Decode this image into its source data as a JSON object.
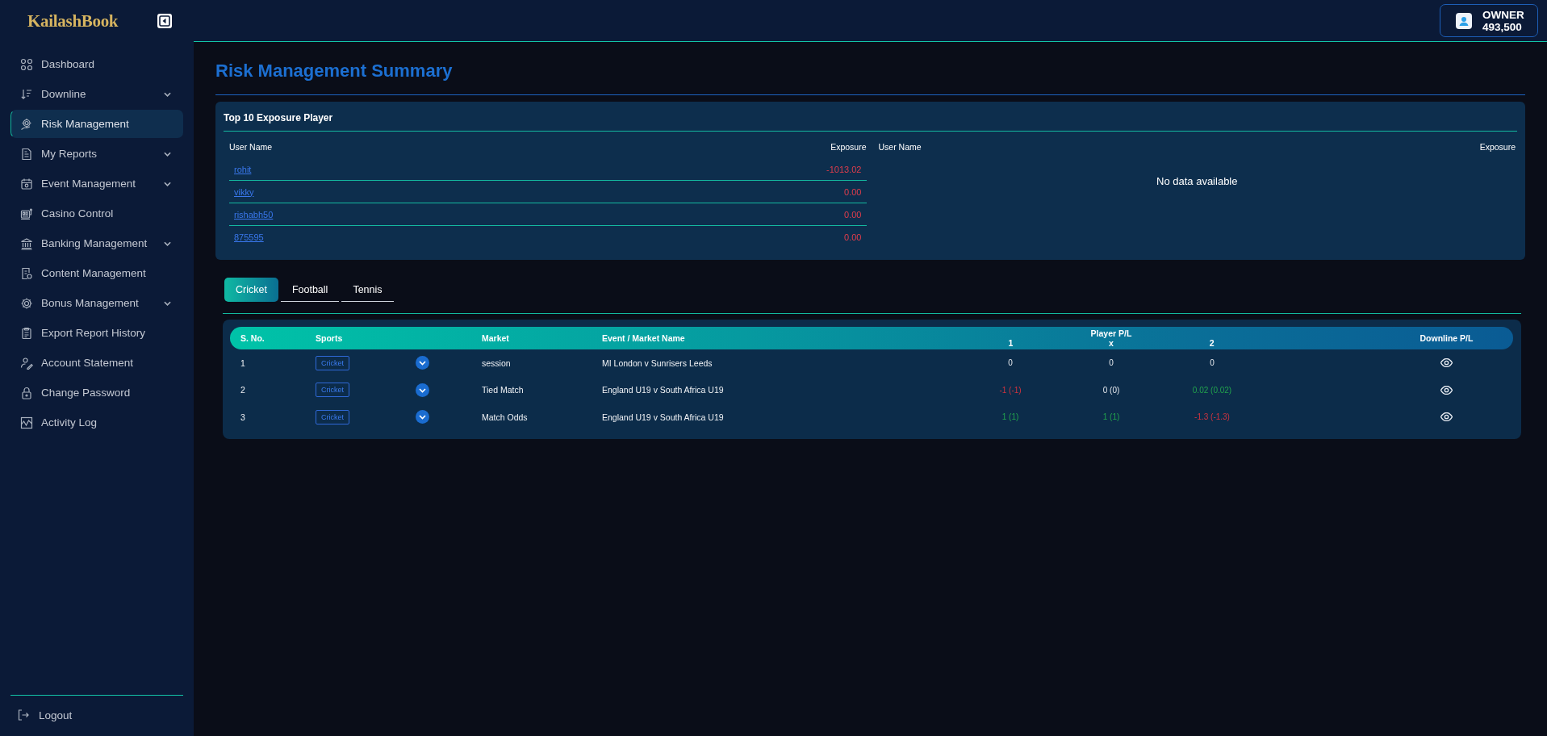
{
  "sidebar": {
    "logo": "KailashBook",
    "items": [
      {
        "label": "Dashboard",
        "kind": "link",
        "selected": false
      },
      {
        "label": "Downline",
        "kind": "group",
        "selected": false
      },
      {
        "label": "Risk Management",
        "kind": "link",
        "selected": true
      },
      {
        "label": "My Reports",
        "kind": "group",
        "selected": false
      },
      {
        "label": "Event Management",
        "kind": "group",
        "selected": false
      },
      {
        "label": "Casino Control",
        "kind": "link",
        "selected": false
      },
      {
        "label": "Banking Management",
        "kind": "group",
        "selected": false
      },
      {
        "label": "Content Management",
        "kind": "link",
        "selected": false
      },
      {
        "label": "Bonus Management",
        "kind": "group",
        "selected": false
      },
      {
        "label": "Export Report History",
        "kind": "link",
        "selected": false
      },
      {
        "label": "Account Statement",
        "kind": "link",
        "selected": false
      },
      {
        "label": "Change Password",
        "kind": "link",
        "selected": false
      },
      {
        "label": "Activity Log",
        "kind": "link",
        "selected": false
      }
    ],
    "logout": "Logout"
  },
  "top_bar": {
    "account": {
      "role": "OWNER",
      "balance": "493,500"
    }
  },
  "page": {
    "title": "Risk Management Summary"
  },
  "exposure_panel": {
    "title": "Top 10 Exposure Player",
    "tables": [
      {
        "columns": [
          "User Name",
          "Exposure"
        ],
        "rows": [
          {
            "user_name": "rohit",
            "exposure": "-1013.02"
          },
          {
            "user_name": "vikky",
            "exposure": "0.00"
          },
          {
            "user_name": "rishabh50",
            "exposure": "0.00"
          },
          {
            "user_name": "875595",
            "exposure": "0.00"
          }
        ]
      },
      {
        "columns": [
          "User Name",
          "Exposure"
        ],
        "empty_message": "No data available"
      }
    ]
  },
  "sport_tabs": [
    {
      "label": "Cricket",
      "selected": true
    },
    {
      "label": "Football",
      "selected": false
    },
    {
      "label": "Tennis",
      "selected": false
    }
  ],
  "markets_table": {
    "columns": [
      "S. No.",
      "Sports",
      "Market",
      "Event / Market Name"
    ],
    "player_pl": {
      "label": "Player P/L",
      "columns": [
        "1",
        "x",
        "2"
      ]
    },
    "downline_column": "Downline P/L",
    "rows": [
      {
        "s_no": "1",
        "sport": "Cricket",
        "expanded": false,
        "market": "session",
        "event": "MI London v Sunrisers Leeds",
        "player_pl": [
          {
            "value": "0"
          },
          {
            "value": "0"
          },
          {
            "value": "0"
          }
        ]
      },
      {
        "s_no": "2",
        "sport": "Cricket",
        "expanded": false,
        "market": "Tied Match",
        "event": "England U19 v South Africa U19",
        "player_pl": [
          {
            "value": "-1 (-1)",
            "color": "#d0333f"
          },
          {
            "value": "0 (0)"
          },
          {
            "value": "0.02 (0.02)",
            "color": "#22a34d"
          }
        ]
      },
      {
        "s_no": "3",
        "sport": "Cricket",
        "expanded": false,
        "market": "Match Odds",
        "event": "England U19 v South Africa U19",
        "player_pl": [
          {
            "value": "1 (1)",
            "color": "#22a34d"
          },
          {
            "value": "1 (1)",
            "color": "#22a34d"
          },
          {
            "value": "-1.3 (-1.3)",
            "color": "#d0333f"
          }
        ]
      }
    ]
  }
}
